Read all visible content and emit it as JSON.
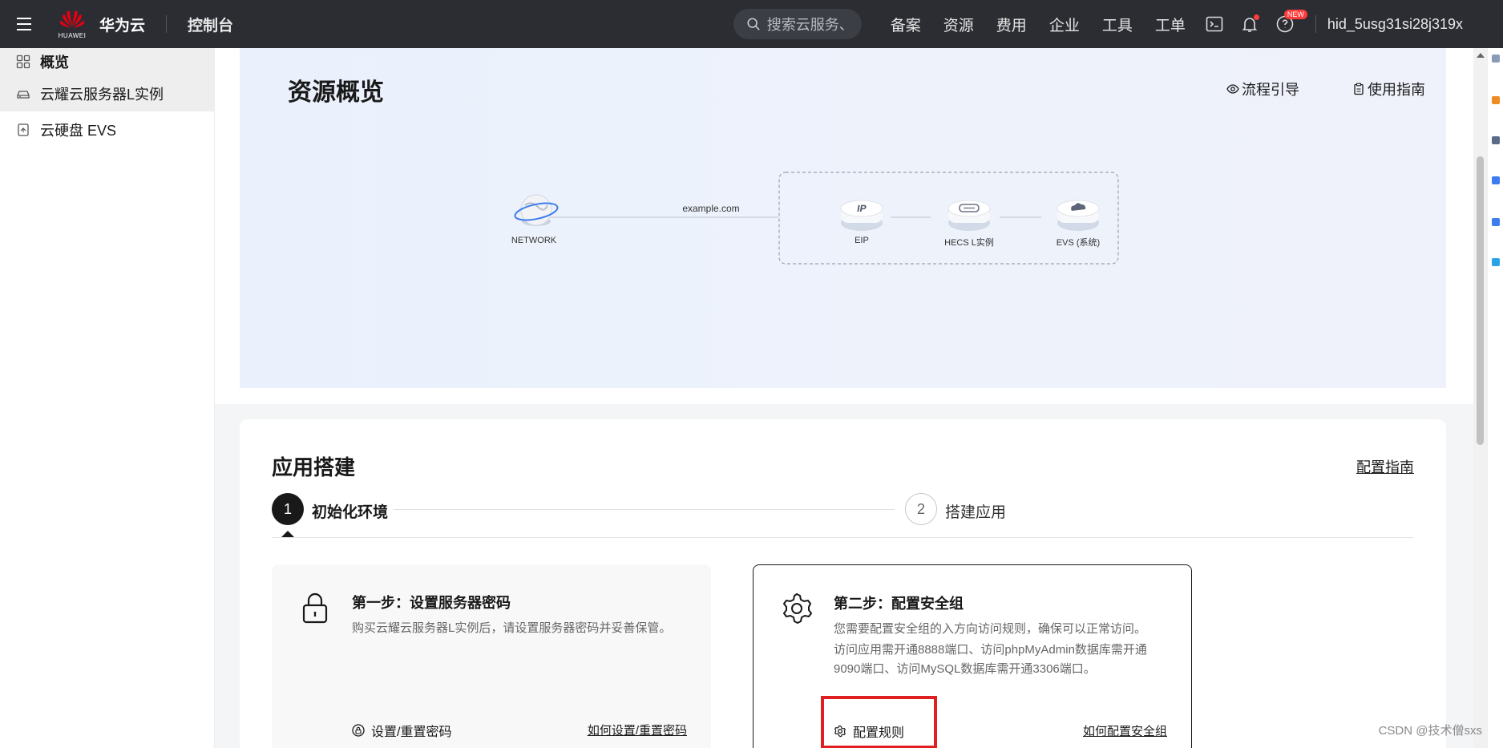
{
  "topbar": {
    "brand": "华为云",
    "logo_text": "HUAWEI",
    "console": "控制台",
    "search_placeholder": "搜索云服务、",
    "nav": [
      "备案",
      "资源",
      "费用",
      "企业",
      "工具",
      "工单"
    ],
    "new_badge": "NEW",
    "user": "hid_5usg31si28j319x"
  },
  "sidebar": {
    "items": [
      {
        "label": "概览",
        "icon": "grid-icon"
      },
      {
        "label": "云耀云服务器L实例",
        "icon": "cloud-server-icon"
      },
      {
        "label": "云硬盘 EVS",
        "icon": "disk-icon"
      }
    ]
  },
  "overview": {
    "title": "资源概览",
    "flow_guide": "流程引导",
    "user_guide": "使用指南",
    "topology": {
      "domain": "example.com",
      "nodes": [
        "NETWORK",
        "EIP",
        "HECS L实例",
        "EVS (系统)"
      ]
    }
  },
  "build": {
    "title": "应用搭建",
    "guide": "配置指南",
    "steps": [
      {
        "num": "1",
        "label": "初始化环境"
      },
      {
        "num": "2",
        "label": "搭建应用"
      }
    ],
    "cards": [
      {
        "title": "第一步：设置服务器密码",
        "desc": "购买云耀云服务器L实例后，请设置服务器密码并妥善保管。",
        "action": "设置/重置密码",
        "link": "如何设置/重置密码"
      },
      {
        "title": "第二步：配置安全组",
        "desc1": "您需要配置安全组的入方向访问规则，确保可以正常访问。",
        "desc2": "访问应用需开通8888端口、访问phpMyAdmin数据库需开通9090端口、访问MySQL数据库需开通3306端口。",
        "action": "配置规则",
        "link": "如何配置安全组"
      }
    ]
  },
  "watermark": "CSDN @技术僧sxs",
  "colors": {
    "topbar": "#2b2d33",
    "highlight": "#e02020",
    "accent": "#191919"
  }
}
